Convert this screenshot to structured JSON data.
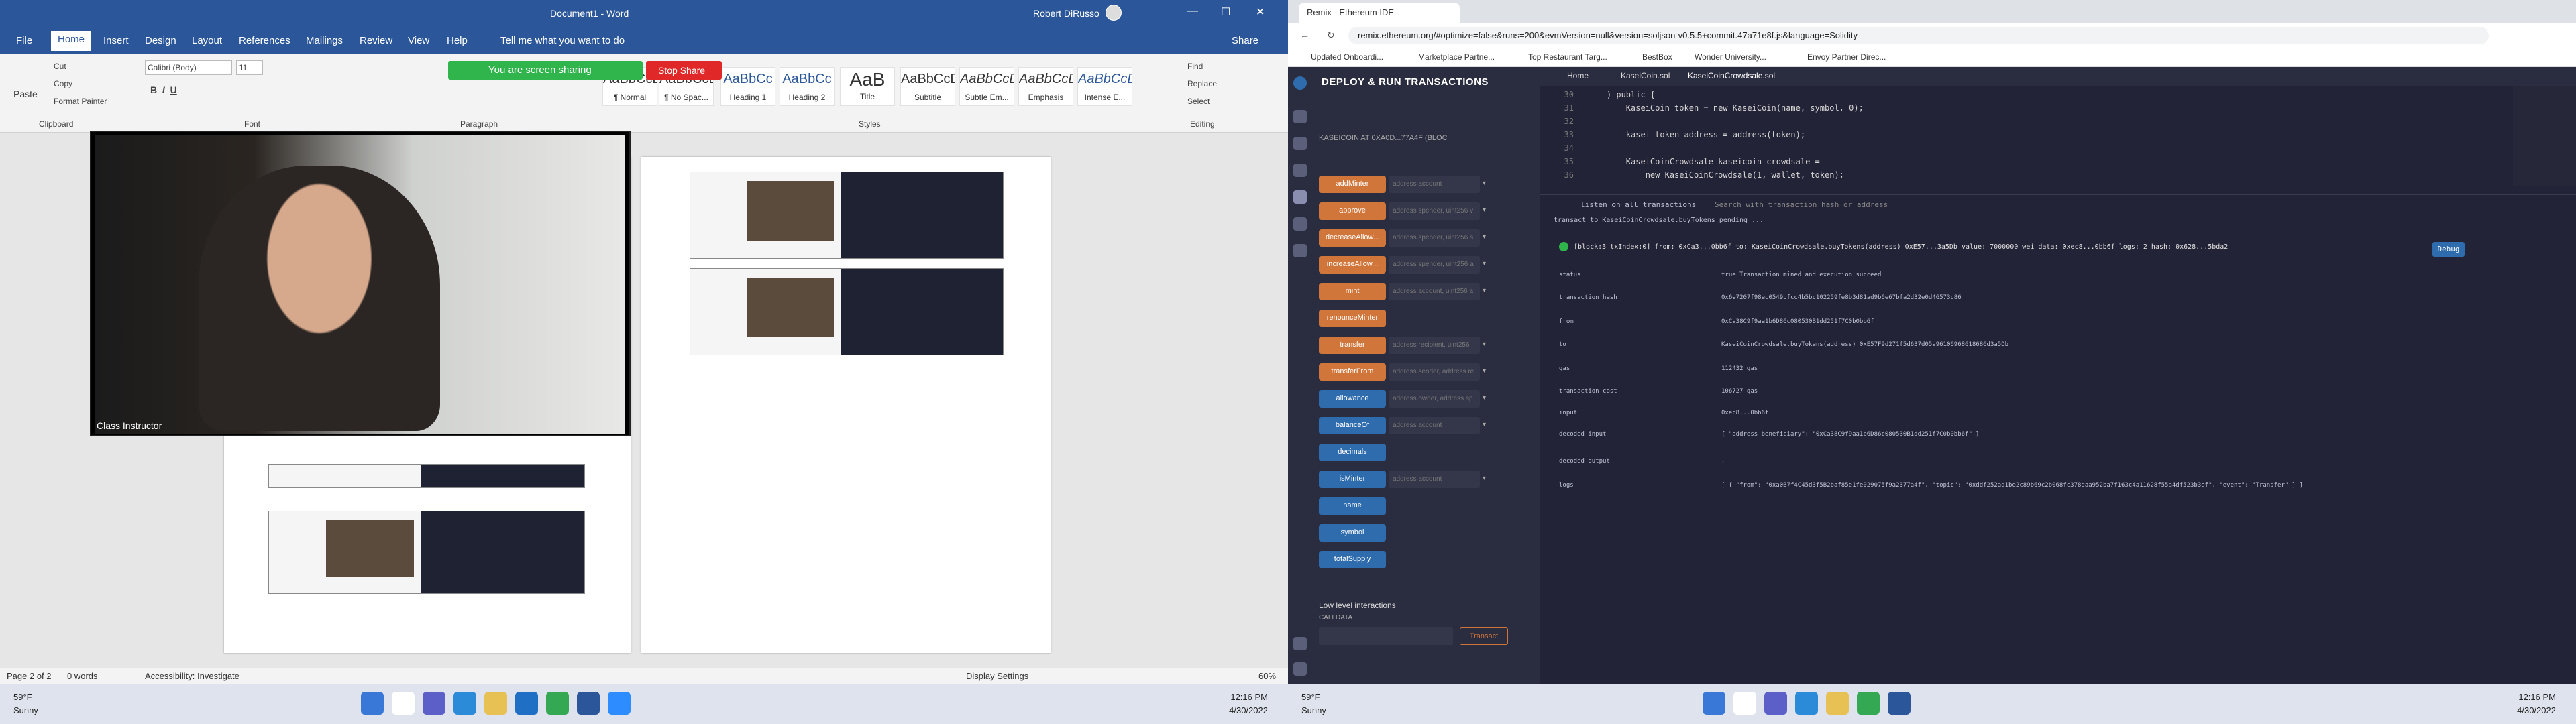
{
  "word": {
    "doc_title": "Document1  -  Word",
    "user": "Robert DiRusso",
    "tabs": [
      "File",
      "Home",
      "Insert",
      "Design",
      "Layout",
      "References",
      "Mailings",
      "Review",
      "View",
      "Help"
    ],
    "tell_me": "Tell me what you want to do",
    "share": "Share",
    "clipboard": {
      "paste": "Paste",
      "cut": "Cut",
      "copy": "Copy",
      "format_painter": "Format Painter",
      "label": "Clipboard"
    },
    "font": {
      "name": "Calibri (Body)",
      "size": "11",
      "label": "Font"
    },
    "paragraph_label": "Paragraph",
    "styles": [
      {
        "preview": "AaBbCcDd",
        "name": "¶ Normal"
      },
      {
        "preview": "AaBbCcDd",
        "name": "¶ No Spac..."
      },
      {
        "preview": "AaBbCc",
        "name": "Heading 1"
      },
      {
        "preview": "AaBbCc",
        "name": "Heading 2"
      },
      {
        "preview": "AaB",
        "name": "Title"
      },
      {
        "preview": "AaBbCcD",
        "name": "Subtitle"
      },
      {
        "preview": "AaBbCcDd",
        "name": "Subtle Em..."
      },
      {
        "preview": "AaBbCcDd",
        "name": "Emphasis"
      },
      {
        "preview": "AaBbCcDd",
        "name": "Intense E..."
      }
    ],
    "styles_label": "Styles",
    "editing": {
      "find": "Find",
      "replace": "Replace",
      "select": "Select",
      "label": "Editing"
    },
    "screen_sharing": "You are screen sharing",
    "stop_share": "Stop Share",
    "video_label": "Class Instructor",
    "status": {
      "page": "Page 2 of 2",
      "words": "0 words",
      "accessibility": "Accessibility: Investigate",
      "display": "Display Settings",
      "zoom": "60%"
    }
  },
  "left_taskbar": {
    "temp": "59°F",
    "weather": "Sunny",
    "time": "12:16 PM",
    "date": "4/30/2022"
  },
  "right_taskbar": {
    "temp": "59°F",
    "weather": "Sunny",
    "time": "12:16 PM",
    "date": "4/30/2022"
  },
  "chrome": {
    "tab_title": "Remix - Ethereum IDE",
    "url": "remix.ethereum.org/#optimize=false&runs=200&evmVersion=null&version=soljson-v0.5.5+commit.47a71e8f.js&language=Solidity",
    "bookmarks": [
      "Updated Onboardi...",
      "Marketplace Partne...",
      "Top Restaurant Targ...",
      "BestBox",
      "Wonder University...",
      "Envoy Partner Direc..."
    ]
  },
  "remix": {
    "panel_title": "DEPLOY & RUN TRANSACTIONS",
    "contract": "KASEICOIN AT 0XA0D...77A4F (BLOC",
    "functions": [
      {
        "name": "addMinter",
        "placeholder": "address account",
        "color": "orange"
      },
      {
        "name": "approve",
        "placeholder": "address spender, uint256 v",
        "color": "orange"
      },
      {
        "name": "decreaseAllow...",
        "placeholder": "address spender, uint256 s",
        "color": "orange"
      },
      {
        "name": "increaseAllow...",
        "placeholder": "address spender, uint256 a",
        "color": "orange"
      },
      {
        "name": "mint",
        "placeholder": "address account, uint256 a",
        "color": "orange"
      },
      {
        "name": "renounceMinter",
        "placeholder": "",
        "color": "orange"
      },
      {
        "name": "transfer",
        "placeholder": "address recipient, uint256",
        "color": "orange"
      },
      {
        "name": "transferFrom",
        "placeholder": "address sender, address re",
        "color": "orange"
      },
      {
        "name": "allowance",
        "placeholder": "address owner, address sp",
        "color": "blue"
      },
      {
        "name": "balanceOf",
        "placeholder": "address account",
        "color": "blue"
      },
      {
        "name": "decimals",
        "placeholder": "",
        "color": "blue"
      },
      {
        "name": "isMinter",
        "placeholder": "address account",
        "color": "blue"
      },
      {
        "name": "name",
        "placeholder": "",
        "color": "blue"
      },
      {
        "name": "symbol",
        "placeholder": "",
        "color": "blue"
      },
      {
        "name": "totalSupply",
        "placeholder": "",
        "color": "blue"
      }
    ],
    "low_level": "Low level interactions",
    "calldata": "CALLDATA",
    "transact": "Transact",
    "editor_tabs": [
      "Home",
      "KaseiCoin.sol",
      "KaseiCoinCrowdsale.sol"
    ],
    "code_lines": [
      {
        "n": "30",
        "t": "    ) public {"
      },
      {
        "n": "31",
        "t": "        KaseiCoin token = new KaseiCoin(name, symbol, 0);"
      },
      {
        "n": "32",
        "t": ""
      },
      {
        "n": "33",
        "t": "        kasei_token_address = address(token);"
      },
      {
        "n": "34",
        "t": ""
      },
      {
        "n": "35",
        "t": "        KaseiCoinCrowdsale kaseicoin_crowdsale ="
      },
      {
        "n": "36",
        "t": "            new KaseiCoinCrowdsale(1, wallet, token);"
      }
    ],
    "listen": "listen on all transactions",
    "search": "Search with transaction hash or address",
    "pending": "transact to KaseiCoinCrowdsale.buyTokens pending ...",
    "tx_summary": "[block:3 txIndex:0] from: 0xCa3...0bb6f to: KaseiCoinCrowdsale.buyTokens(address) 0xE57...3a5Db value: 7000000 wei data: 0xec8...0bb6f logs: 2 hash: 0x628...5bda2",
    "debug": "Debug",
    "rows": [
      {
        "k": "status",
        "v": "true Transaction mined and execution succeed"
      },
      {
        "k": "transaction hash",
        "v": "0x6e7207f98ec0549bfcc4b5bc102259fe8b3d81ad9b6e67bfa2d32e0d46573c86"
      },
      {
        "k": "from",
        "v": "0xCa38C9f9aa1b6D86c080530B1dd251f7C0b0bb6f"
      },
      {
        "k": "to",
        "v": "KaseiCoinCrowdsale.buyTokens(address) 0xE57F9d271f5d637d05a96106968618686d3a5Db"
      },
      {
        "k": "gas",
        "v": "112432 gas"
      },
      {
        "k": "transaction cost",
        "v": "106727 gas"
      },
      {
        "k": "input",
        "v": "0xec8...0bb6f"
      },
      {
        "k": "decoded input",
        "v": "{ \"address beneficiary\": \"0xCa38C9f9aa1b6D86c080530B1dd251f7C0b0bb6f\" }"
      },
      {
        "k": "decoded output",
        "v": "-"
      },
      {
        "k": "logs",
        "v": "[ { \"from\": \"0xa0B7f4C45d3f5B2baf85e1fe029075f9a2377a4f\", \"topic\": \"0xddf252ad1be2c89b69c2b068fc378daa952ba7f163c4a11628f55a4df523b3ef\", \"event\": \"Transfer\" } ]"
      }
    ]
  }
}
